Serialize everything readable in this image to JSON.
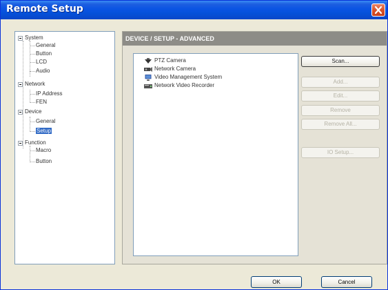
{
  "window": {
    "title": "Remote Setup"
  },
  "tree": {
    "items": [
      {
        "label": "System",
        "level": 0,
        "expander": true
      },
      {
        "label": "General",
        "level": 1
      },
      {
        "label": "Button",
        "level": 1
      },
      {
        "label": "LCD",
        "level": 1
      },
      {
        "label": "Audio",
        "level": 1
      },
      {
        "label": "Network",
        "level": 0,
        "expander": true
      },
      {
        "label": "IP Address",
        "level": 1
      },
      {
        "label": "FEN",
        "level": 1
      },
      {
        "label": "Device",
        "level": 0,
        "expander": true
      },
      {
        "label": "General",
        "level": 1
      },
      {
        "label": "Setup",
        "level": 1,
        "selected": true
      },
      {
        "label": "Function",
        "level": 0,
        "expander": true
      },
      {
        "label": "Macro",
        "level": 1
      },
      {
        "label": "Button",
        "level": 1
      }
    ]
  },
  "panel": {
    "header": "DEVICE / SETUP - ADVANCED",
    "devices": [
      {
        "label": "PTZ Camera",
        "icon": "ptz-camera-icon"
      },
      {
        "label": "Network Camera",
        "icon": "network-camera-icon"
      },
      {
        "label": "Video Management System",
        "icon": "monitor-icon"
      },
      {
        "label": "Network Video Recorder",
        "icon": "recorder-icon"
      }
    ],
    "buttons": {
      "scan": "Scan...",
      "add": "Add...",
      "edit": "Edit...",
      "remove": "Remove",
      "remove_all": "Remove All...",
      "io_setup": "IO Setup..."
    }
  },
  "footer": {
    "ok": "OK",
    "cancel": "Cancel"
  },
  "colors": {
    "title_bar": "#0a54e3",
    "selection": "#316ac5",
    "panel_header": "#8d8c87",
    "close_button": "#d9542b"
  }
}
